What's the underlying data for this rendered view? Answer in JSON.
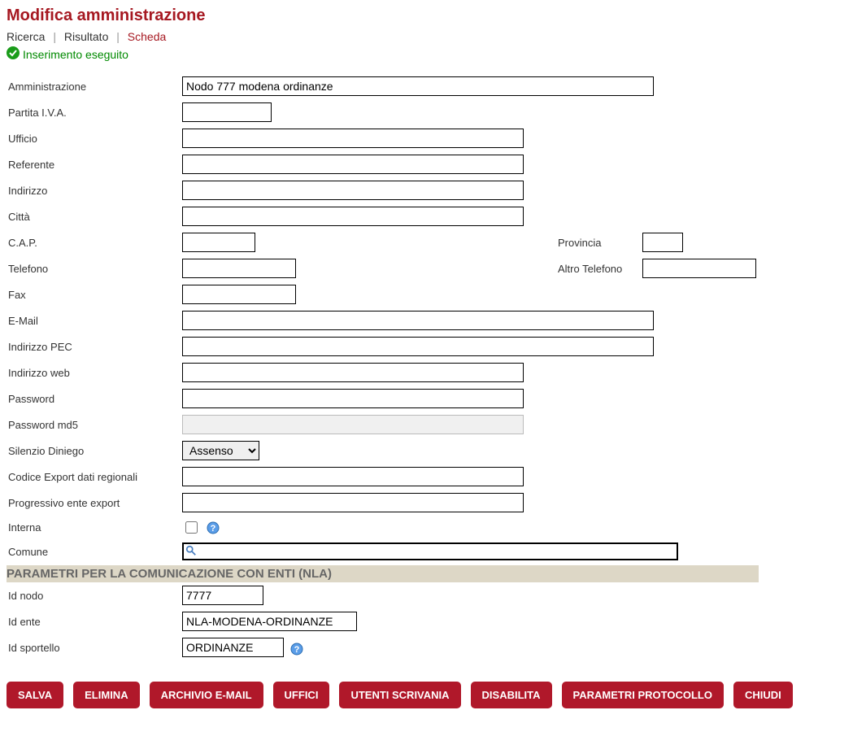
{
  "title": "Modifica amministrazione",
  "breadcrumb": {
    "ricerca": "Ricerca",
    "risultato": "Risultato",
    "scheda": "Scheda"
  },
  "status": "Inserimento eseguito",
  "labels": {
    "amministrazione": "Amministrazione",
    "piva": "Partita I.V.A.",
    "ufficio": "Ufficio",
    "referente": "Referente",
    "indirizzo": "Indirizzo",
    "citta": "Città",
    "cap": "C.A.P.",
    "provincia": "Provincia",
    "telefono": "Telefono",
    "altro_telefono": "Altro Telefono",
    "fax": "Fax",
    "email": "E-Mail",
    "pec": "Indirizzo PEC",
    "web": "Indirizzo web",
    "password": "Password",
    "password_md5": "Password md5",
    "silenzio": "Silenzio Diniego",
    "codice_export": "Codice Export dati regionali",
    "progressivo": "Progressivo ente export",
    "interna": "Interna",
    "comune": "Comune",
    "id_nodo": "Id nodo",
    "id_ente": "Id ente",
    "id_sportello": "Id sportello"
  },
  "values": {
    "amministrazione": "Nodo 777 modena ordinanze",
    "piva": "",
    "ufficio": "",
    "referente": "",
    "indirizzo": "",
    "citta": "",
    "cap": "",
    "provincia": "",
    "telefono": "",
    "altro_telefono": "",
    "fax": "",
    "email": "",
    "pec": "",
    "web": "",
    "password": "",
    "password_md5": "",
    "silenzio": "Assenso",
    "codice_export": "",
    "progressivo": "",
    "id_nodo": "7777",
    "id_ente": "NLA-MODENA-ORDINANZE",
    "id_sportello": "ORDINANZE"
  },
  "section_nla": "PARAMETRI PER LA COMUNICAZIONE CON ENTI (NLA)",
  "buttons": {
    "salva": "SALVA",
    "elimina": "ELIMINA",
    "archivio": "ARCHIVIO E-MAIL",
    "uffici": "UFFICI",
    "utenti": "UTENTI SCRIVANIA",
    "disabilita": "DISABILITA",
    "parametri": "PARAMETRI PROTOCOLLO",
    "chiudi": "CHIUDI"
  }
}
